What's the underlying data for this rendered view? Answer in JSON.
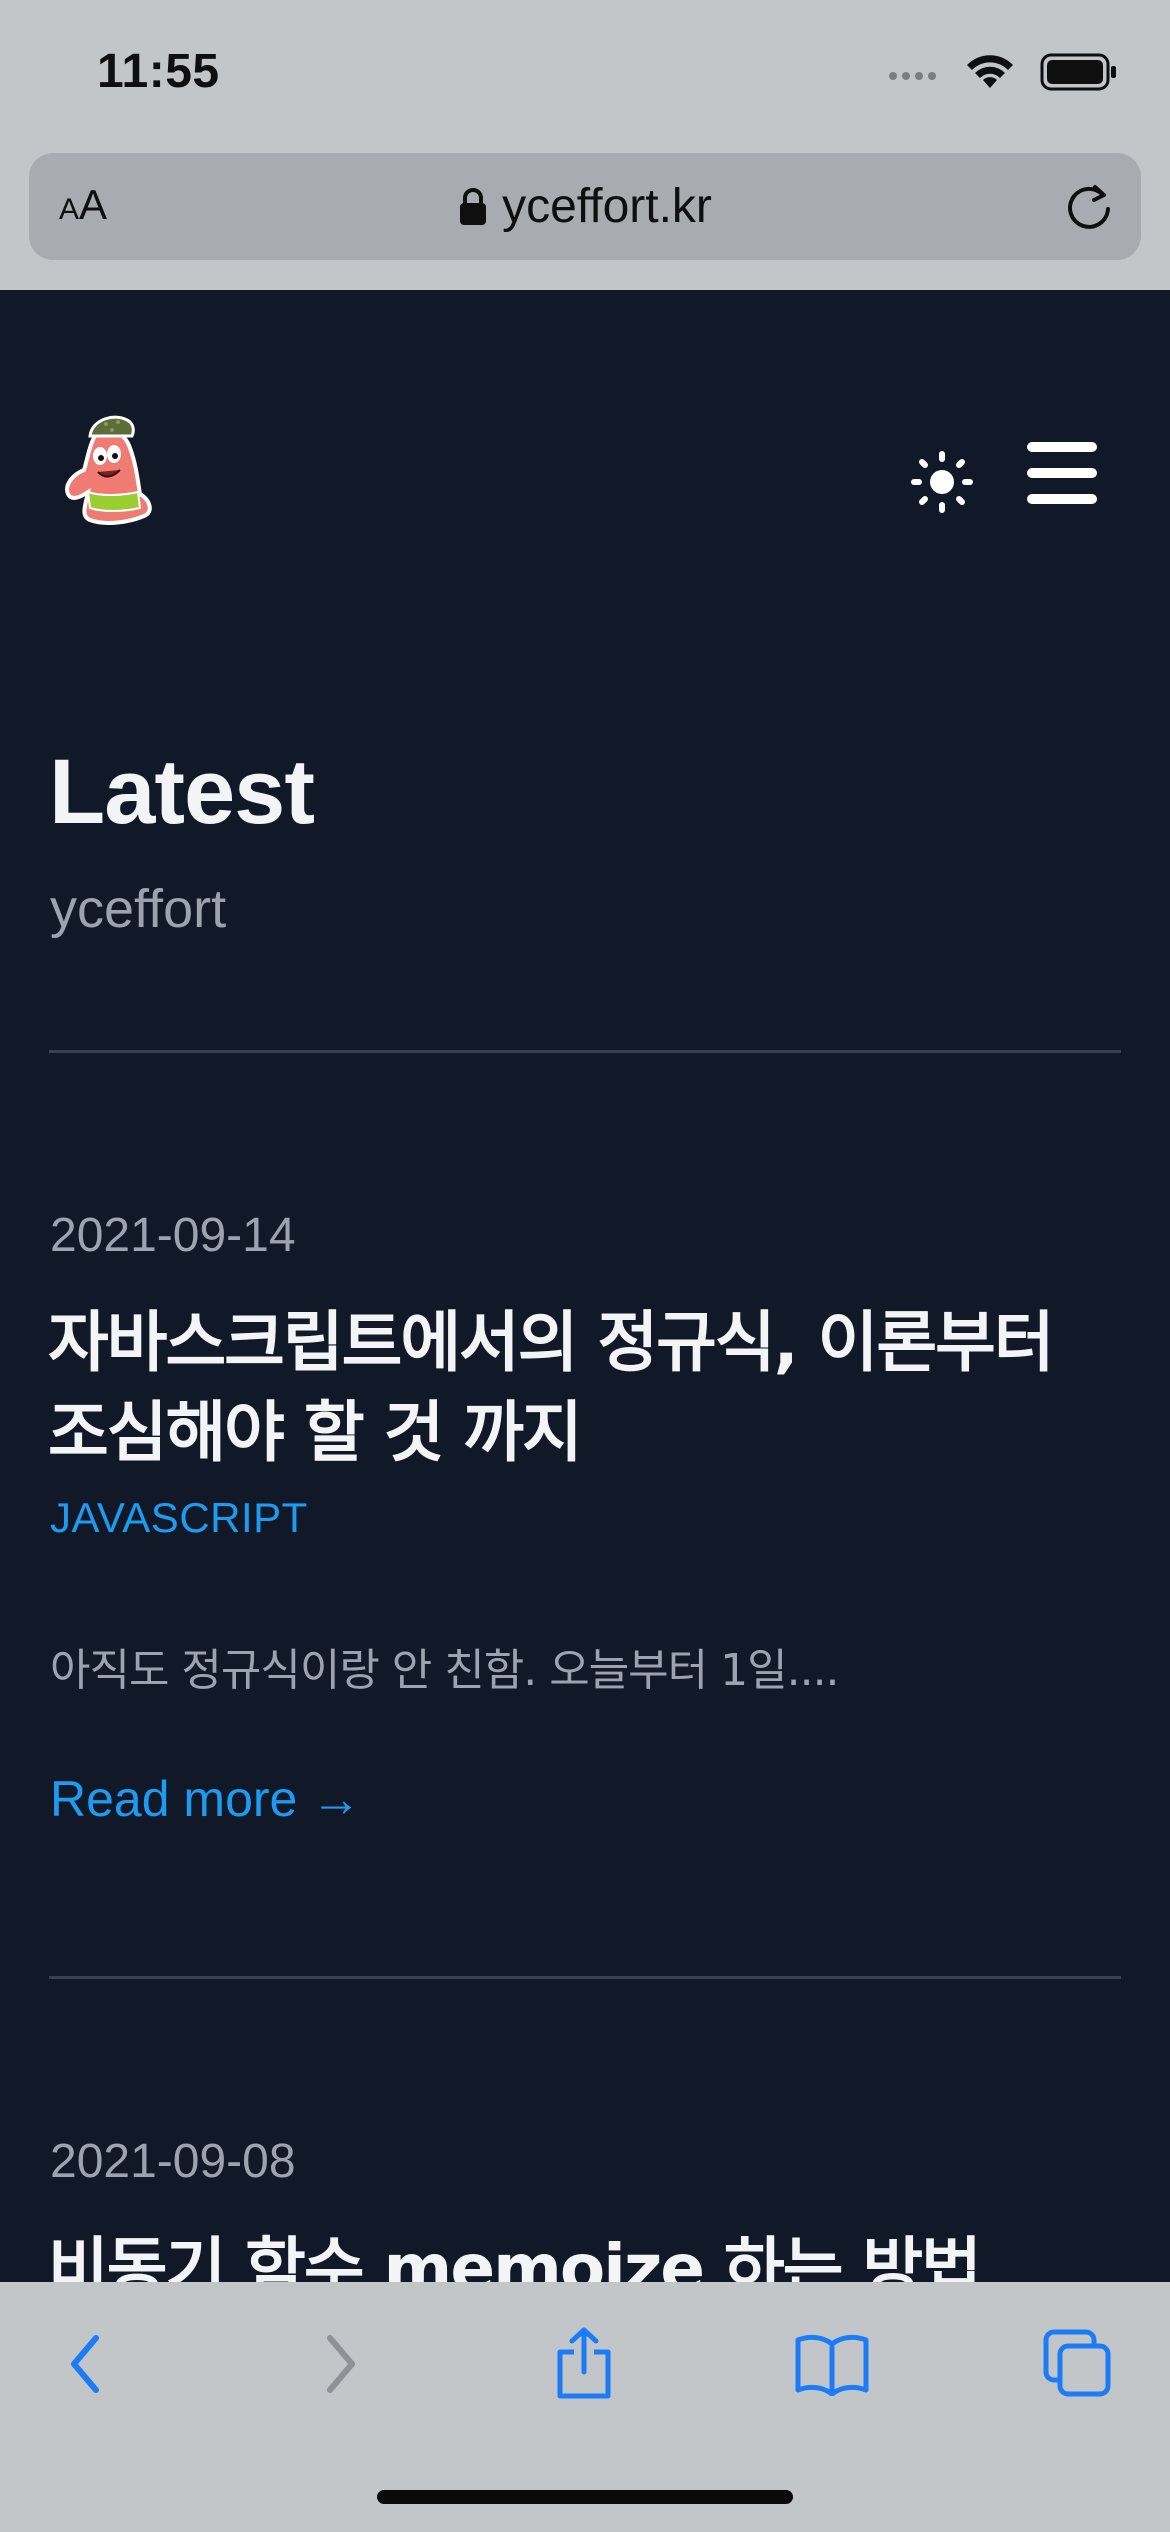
{
  "status_bar": {
    "time": "11:55",
    "icons": [
      "cellular-signal-icon",
      "wifi-icon",
      "battery-icon"
    ]
  },
  "browser": {
    "text_size_small": "A",
    "text_size_large": "A",
    "url": "yceffort.kr",
    "icons": [
      "lock-icon",
      "reload-icon"
    ]
  },
  "header": {
    "icons": [
      "site-logo",
      "sun-icon",
      "hamburger-menu-icon"
    ]
  },
  "page": {
    "title": "Latest",
    "subtitle": "yceffort"
  },
  "posts": [
    {
      "date": "2021-09-14",
      "title": "자바스크립트에서의 정규식, 이론부터 조심해야 할 것 까지",
      "tag": "JAVASCRIPT",
      "summary": "아직도 정규식이랑 안 친함. 오늘부터 1일....",
      "read_more": "Read more →"
    },
    {
      "date": "2021-09-08",
      "title": "비동기 함수 memoize 하는 방법"
    }
  ],
  "toolbar": {
    "icons": [
      "back-icon",
      "forward-icon",
      "share-icon",
      "bookmarks-icon",
      "tabs-icon"
    ]
  },
  "colors": {
    "background": "#111827",
    "accent": "#1d9bf0",
    "browser_chrome": "#c3c6c9"
  }
}
